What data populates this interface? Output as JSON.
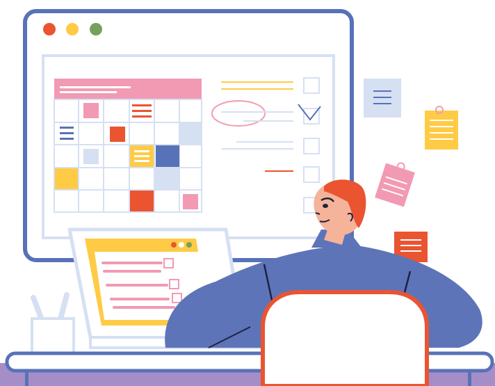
{
  "illustration": {
    "subject": "person-planning-schedule-at-desk",
    "colors": {
      "outline": "#5872b8",
      "sweater": "#5e74b9",
      "pink": "#f29ab3",
      "yellow": "#ffcb45",
      "red": "#ea5431",
      "light_blue": "#d6e0f3",
      "hair": "#ea5431",
      "skin": "#f5b39a",
      "desk_purple": "#a58ec7"
    },
    "window_dots": [
      "#ea5431",
      "#ffcb45",
      "#78a05a"
    ],
    "icons": [
      "calendar-grid-icon",
      "checklist-icon",
      "sticky-note-icon",
      "laptop-icon",
      "pen-holder-icon",
      "chair-icon"
    ]
  }
}
